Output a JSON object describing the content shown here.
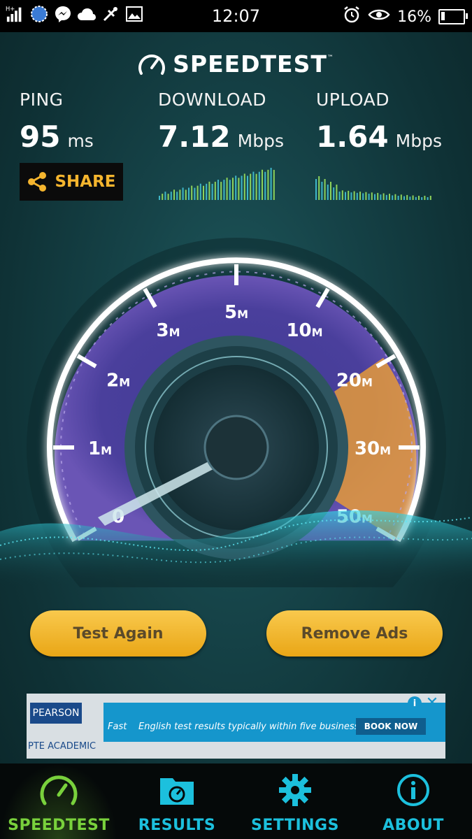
{
  "status_bar": {
    "time": "12:07",
    "battery": "16%",
    "battery_level": 0.16,
    "network": "H+",
    "icons_left": [
      "signal-icon",
      "browser-icon",
      "messenger-icon",
      "cloud-icon",
      "usb-icon",
      "gallery-icon"
    ],
    "icons_right": [
      "alarm-icon",
      "eye-icon"
    ]
  },
  "app": {
    "logo": "SPEEDTEST",
    "logo_mark": "™"
  },
  "metrics": {
    "ping": {
      "label": "PING",
      "value": "95",
      "unit": "ms"
    },
    "download": {
      "label": "DOWNLOAD",
      "value": "7.12",
      "unit": "Mbps"
    },
    "upload": {
      "label": "UPLOAD",
      "value": "1.64",
      "unit": "Mbps"
    }
  },
  "share_label": "SHARE",
  "gauge": {
    "ticks": [
      {
        "num": "0",
        "unit": ""
      },
      {
        "num": "1",
        "unit": "M"
      },
      {
        "num": "2",
        "unit": "M"
      },
      {
        "num": "3",
        "unit": "M"
      },
      {
        "num": "5",
        "unit": "M"
      },
      {
        "num": "10",
        "unit": "M"
      },
      {
        "num": "20",
        "unit": "M"
      },
      {
        "num": "30",
        "unit": "M"
      },
      {
        "num": "50",
        "unit": "M"
      }
    ],
    "needle_value": "0",
    "colors": {
      "ring": "#ffffff",
      "purple": "#5a3d9a",
      "orange": "#f0a030",
      "sparkline": "#8fd35a"
    }
  },
  "buttons": {
    "test_again": "Test Again",
    "remove_ads": "Remove Ads"
  },
  "ad": {
    "brand": "PEARSON",
    "product": "PTE ACADEMIC",
    "lead": "Fast",
    "text": "English test results typically within five business days.",
    "cta": "BOOK NOW"
  },
  "nav": [
    {
      "label": "SPEEDTEST",
      "icon": "speedometer-icon",
      "active": true
    },
    {
      "label": "RESULTS",
      "icon": "results-folder-icon",
      "active": false
    },
    {
      "label": "SETTINGS",
      "icon": "gear-icon",
      "active": false
    },
    {
      "label": "ABOUT",
      "icon": "info-icon",
      "active": false
    }
  ]
}
